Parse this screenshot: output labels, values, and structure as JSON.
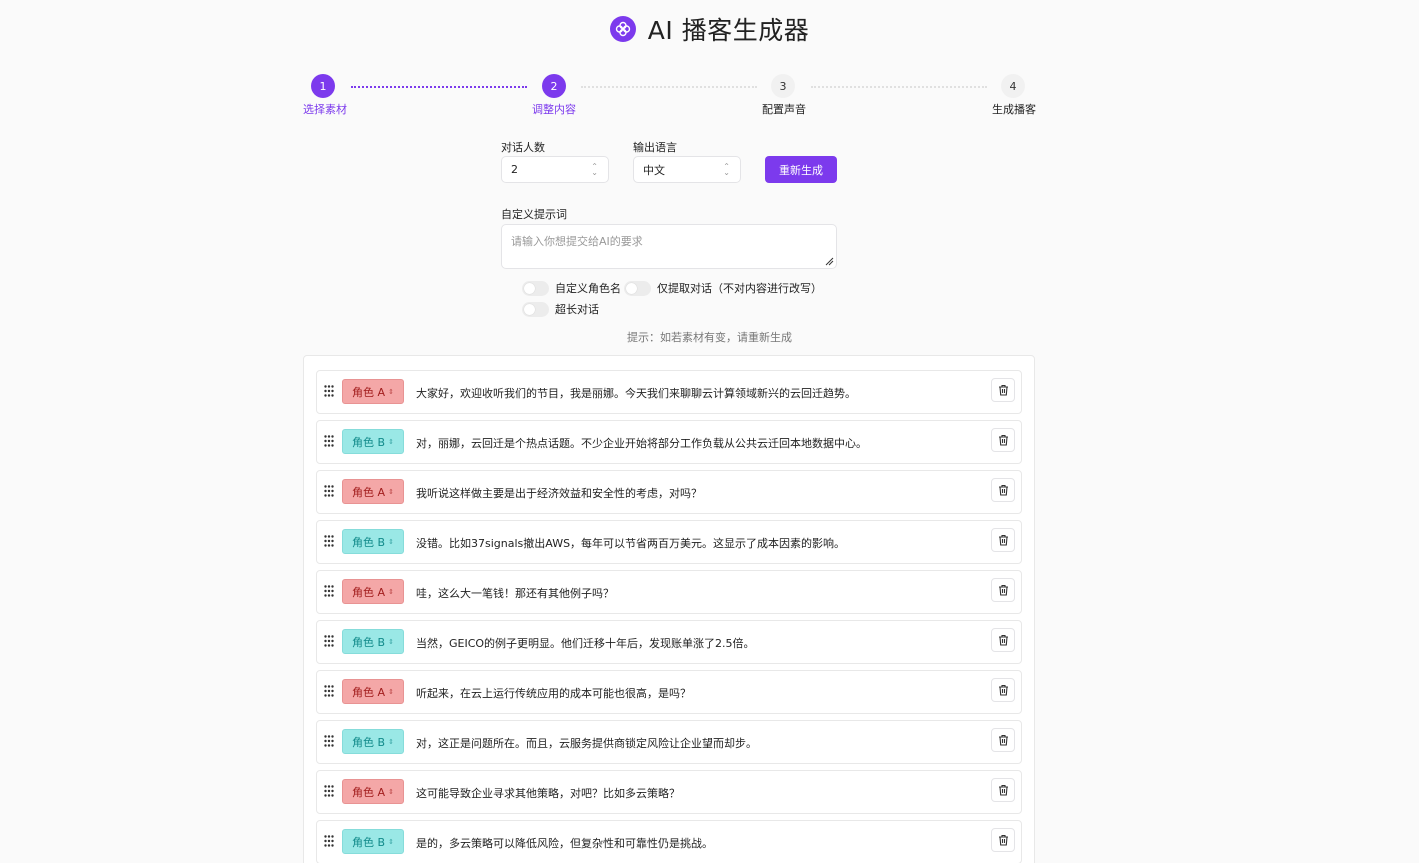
{
  "header": {
    "title": "AI 播客生成器",
    "logo_icon": "flower-logo-icon"
  },
  "steps": [
    {
      "num": "1",
      "label": "选择素材",
      "state": "done"
    },
    {
      "num": "2",
      "label": "调整内容",
      "state": "active"
    },
    {
      "num": "3",
      "label": "配置声音",
      "state": "pending"
    },
    {
      "num": "4",
      "label": "生成播客",
      "state": "pending"
    }
  ],
  "form": {
    "speakers_label": "对话人数",
    "speakers_value": "2",
    "language_label": "输出语言",
    "language_value": "中文",
    "regenerate_label": "重新生成",
    "prompt_label": "自定义提示词",
    "prompt_placeholder": "请输入你想提交给AI的要求",
    "toggle_custom_roles": "自定义角色名",
    "toggle_extract_only": "仅提取对话（不对内容进行改写）",
    "toggle_long_dialogue": "超长对话",
    "hint": "提示：如若素材有变，请重新生成"
  },
  "colors": {
    "accent": "#7c3aed",
    "role_a": "#f4a7a7",
    "role_b": "#9ae8e6"
  },
  "dialogue": [
    {
      "role": "角色 A",
      "kind": "a",
      "text": "大家好，欢迎收听我们的节目，我是丽娜。今天我们来聊聊云计算领域新兴的云回迁趋势。"
    },
    {
      "role": "角色 B",
      "kind": "b",
      "text": "对，丽娜，云回迁是个热点话题。不少企业开始将部分工作负载从公共云迁回本地数据中心。"
    },
    {
      "role": "角色 A",
      "kind": "a",
      "text": "我听说这样做主要是出于经济效益和安全性的考虑，对吗？"
    },
    {
      "role": "角色 B",
      "kind": "b",
      "text": "没错。比如37signals撤出AWS，每年可以节省两百万美元。这显示了成本因素的影响。"
    },
    {
      "role": "角色 A",
      "kind": "a",
      "text": "哇，这么大一笔钱！那还有其他例子吗？"
    },
    {
      "role": "角色 B",
      "kind": "b",
      "text": "当然，GEICO的例子更明显。他们迁移十年后，发现账单涨了2.5倍。"
    },
    {
      "role": "角色 A",
      "kind": "a",
      "text": "听起来，在云上运行传统应用的成本可能也很高，是吗？"
    },
    {
      "role": "角色 B",
      "kind": "b",
      "text": "对，这正是问题所在。而且，云服务提供商锁定风险让企业望而却步。"
    },
    {
      "role": "角色 A",
      "kind": "a",
      "text": "这可能导致企业寻求其他策略，对吧？比如多云策略？"
    },
    {
      "role": "角色 B",
      "kind": "b",
      "text": "是的，多云策略可以降低风险，但复杂性和可靠性仍是挑战。"
    }
  ]
}
